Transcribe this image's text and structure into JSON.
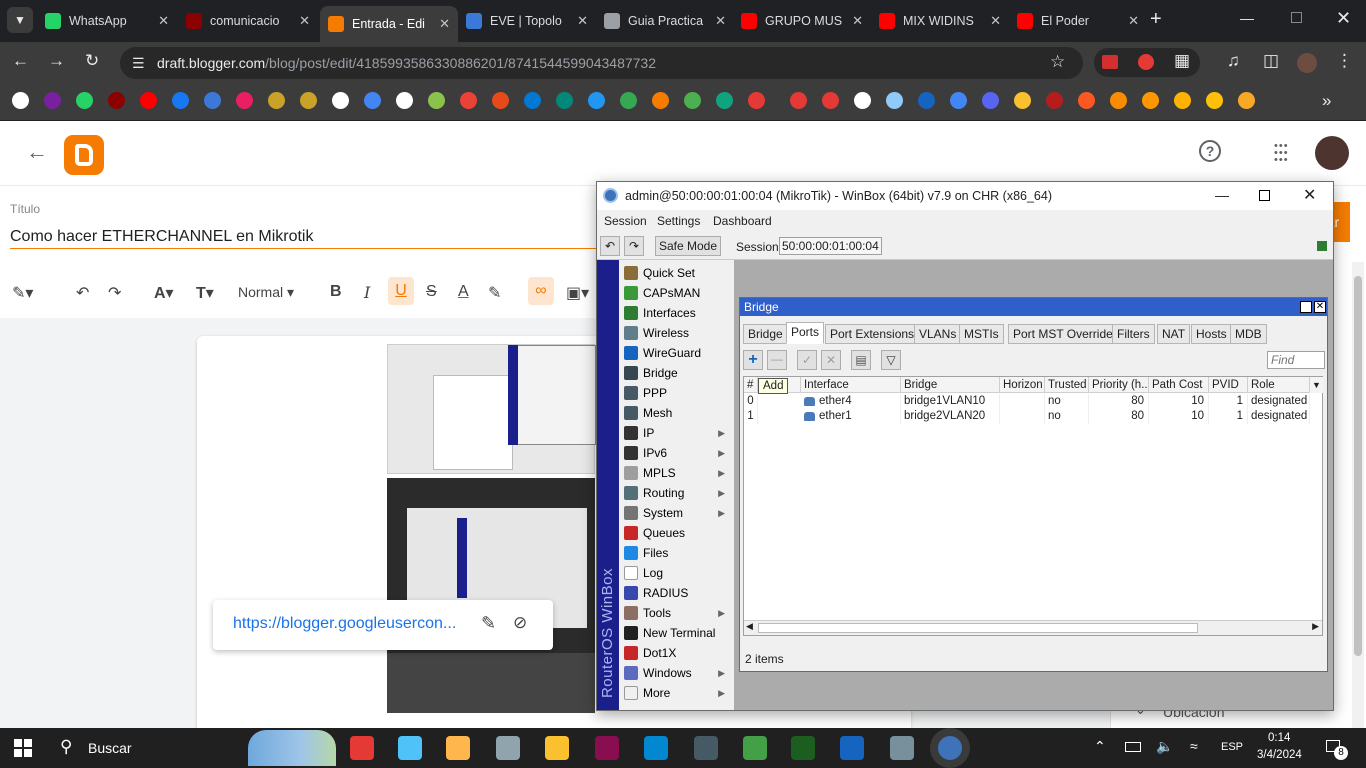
{
  "browser": {
    "tabs": [
      {
        "title": "WhatsApp",
        "color": "#25d366"
      },
      {
        "title": "comunicacio",
        "color": "#8b0000"
      },
      {
        "title": "Entrada - Edi",
        "color": "#f57c00"
      },
      {
        "title": "EVE | Topolo",
        "color": "#3c78d8"
      },
      {
        "title": "Guia Practica",
        "color": "#9aa0a6"
      },
      {
        "title": "GRUPO MUS",
        "color": "#ff0000"
      },
      {
        "title": "MIX WIDINS",
        "color": "#ff0000"
      },
      {
        "title": "El Poder",
        "color": "#ff0000"
      }
    ],
    "url_domain": "draft.blogger.com",
    "url_path": "/blog/post/edit/4185993586330886201/8741544599043487732"
  },
  "editor": {
    "title_label": "Título",
    "title_value": "Como hacer ETHERCHANNEL en Mikrotik",
    "format_label": "Normal",
    "link_popup_url": "https://blogger.googleusercon...",
    "right_panel_label": "Ubicación",
    "publish_label": "ar"
  },
  "winbox": {
    "title": "admin@50:00:00:01:00:04 (MikroTik) - WinBox (64bit) v7.9 on CHR (x86_64)",
    "menu": [
      "Session",
      "Settings",
      "Dashboard"
    ],
    "safe_mode": "Safe Mode",
    "session_label": "Session:",
    "session_value": "50:00:00:01:00:04",
    "side_brand": "RouterOS WinBox",
    "side_items": [
      {
        "label": "Quick Set",
        "color": "#8a6d3b",
        "arrow": ""
      },
      {
        "label": "CAPsMAN",
        "color": "#3a9a3a",
        "arrow": ""
      },
      {
        "label": "Interfaces",
        "color": "#2e7d32",
        "arrow": ""
      },
      {
        "label": "Wireless",
        "color": "#607d8b",
        "arrow": ""
      },
      {
        "label": "WireGuard",
        "color": "#1565c0",
        "arrow": ""
      },
      {
        "label": "Bridge",
        "color": "#37474f",
        "arrow": ""
      },
      {
        "label": "PPP",
        "color": "#455a64",
        "arrow": ""
      },
      {
        "label": "Mesh",
        "color": "#455a64",
        "arrow": ""
      },
      {
        "label": "IP",
        "color": "#333333",
        "arrow": "▶"
      },
      {
        "label": "IPv6",
        "color": "#333333",
        "arrow": "▶"
      },
      {
        "label": "MPLS",
        "color": "#9e9e9e",
        "arrow": "▶"
      },
      {
        "label": "Routing",
        "color": "#546e7a",
        "arrow": "▶"
      },
      {
        "label": "System",
        "color": "#757575",
        "arrow": "▶"
      },
      {
        "label": "Queues",
        "color": "#c62828",
        "arrow": ""
      },
      {
        "label": "Files",
        "color": "#1e88e5",
        "arrow": ""
      },
      {
        "label": "Log",
        "color": "#ffffff",
        "arrow": ""
      },
      {
        "label": "RADIUS",
        "color": "#3949ab",
        "arrow": ""
      },
      {
        "label": "Tools",
        "color": "#8d6e63",
        "arrow": "▶"
      },
      {
        "label": "New Terminal",
        "color": "#212121",
        "arrow": ""
      },
      {
        "label": "Dot1X",
        "color": "#c62828",
        "arrow": ""
      },
      {
        "label": "Windows",
        "color": "#5c6bc0",
        "arrow": "▶"
      },
      {
        "label": "More",
        "color": "#f0f0f0",
        "arrow": "▶"
      }
    ],
    "bridge": {
      "title": "Bridge",
      "tabs": [
        "Bridge",
        "Ports",
        "Port Extensions",
        "VLANs",
        "MSTIs",
        "Port MST Overrides",
        "Filters",
        "NAT",
        "Hosts",
        "MDB"
      ],
      "active_tab": "Ports",
      "find_placeholder": "Find",
      "add_tooltip": "Add",
      "columns": [
        "#",
        "",
        "Interface",
        "Bridge",
        "Horizon",
        "Trusted",
        "Priority (h...",
        "Path Cost",
        "PVID",
        "Role"
      ],
      "rows": [
        {
          "num": "0",
          "interface": "ether4",
          "bridge": "bridge1VLAN10",
          "horizon": "",
          "trusted": "no",
          "priority": "80",
          "path_cost": "10",
          "pvid": "1",
          "role": "designated port"
        },
        {
          "num": "1",
          "interface": "ether1",
          "bridge": "bridge2VLAN20",
          "horizon": "",
          "trusted": "no",
          "priority": "80",
          "path_cost": "10",
          "pvid": "1",
          "role": "designated port"
        }
      ],
      "status": "2 items"
    }
  },
  "taskbar": {
    "search": "Buscar",
    "lang": "ESP",
    "time": "0:14",
    "date": "3/4/2024",
    "notif": "8"
  }
}
